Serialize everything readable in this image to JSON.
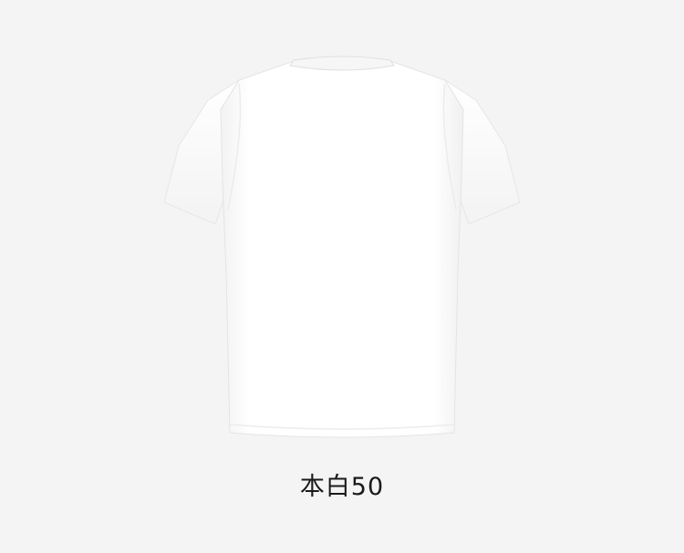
{
  "product": {
    "color_label": "本白50",
    "garment_color": "#ffffff",
    "background_color": "#f4f4f4"
  }
}
